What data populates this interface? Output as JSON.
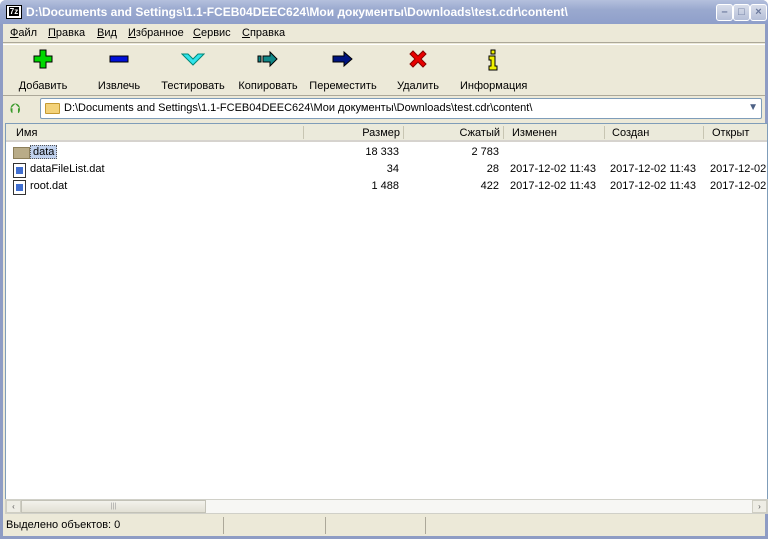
{
  "title": "D:\\Documents and Settings\\1.1-FCEB04DEEC624\\Мои документы\\Downloads\\test.cdr\\content\\",
  "app_icon": "7z",
  "menu": [
    "Файл",
    "Правка",
    "Вид",
    "Избранное",
    "Сервис",
    "Справка"
  ],
  "toolbar": [
    {
      "label": "Добавить",
      "icon": "plus-icon",
      "color": "#00d000"
    },
    {
      "label": "Извлечь",
      "icon": "minus-icon",
      "color": "#0010d8"
    },
    {
      "label": "Тестировать",
      "icon": "check-icon",
      "color": "#30e0e8"
    },
    {
      "label": "Копировать",
      "icon": "copy-arrow-icon",
      "color": "#108888"
    },
    {
      "label": "Переместить",
      "icon": "move-arrow-icon",
      "color": "#001480"
    },
    {
      "label": "Удалить",
      "icon": "delete-x-icon",
      "color": "#e80000"
    },
    {
      "label": "Информация",
      "icon": "info-icon",
      "color": "#f0f000"
    }
  ],
  "address": "D:\\Documents and Settings\\1.1-FCEB04DEEC624\\Мои документы\\Downloads\\test.cdr\\content\\",
  "columns": [
    "Имя",
    "Размер",
    "Сжатый",
    "Изменен",
    "Создан",
    "Открыт"
  ],
  "rows": [
    {
      "name": "data",
      "size": "18 333",
      "packed": "2 783",
      "modified": "",
      "created": "",
      "accessed": "",
      "type": "folder"
    },
    {
      "name": "dataFileList.dat",
      "size": "34",
      "packed": "28",
      "modified": "2017-12-02 11:43",
      "created": "2017-12-02 11:43",
      "accessed": "2017-12-02",
      "type": "file"
    },
    {
      "name": "root.dat",
      "size": "1 488",
      "packed": "422",
      "modified": "2017-12-02 11:43",
      "created": "2017-12-02 11:43",
      "accessed": "2017-12-02",
      "type": "file"
    }
  ],
  "status": "Выделено объектов: 0"
}
